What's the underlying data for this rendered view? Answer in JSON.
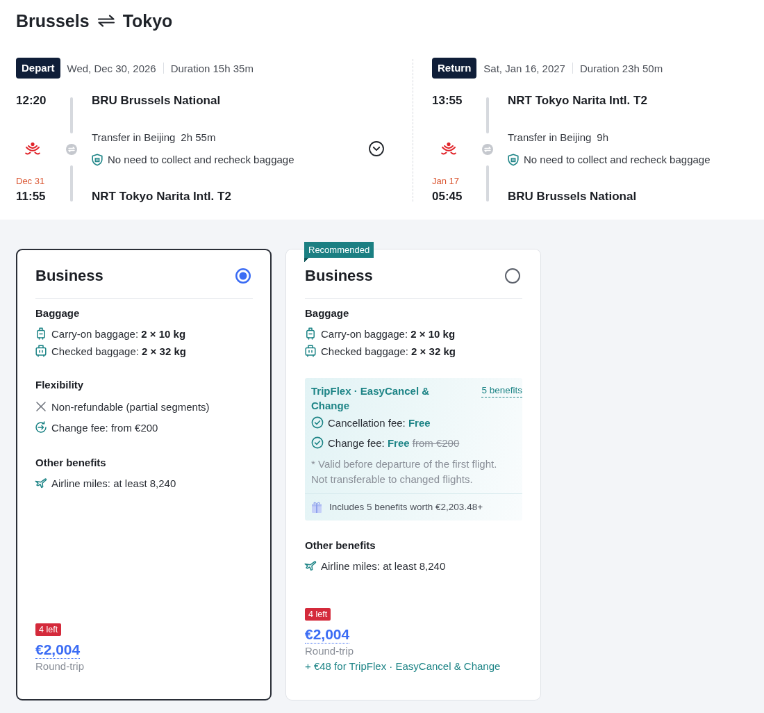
{
  "title": {
    "origin": "Brussels",
    "destination": "Tokyo"
  },
  "legs": [
    {
      "label": "Depart",
      "date": "Wed, Dec 30, 2026",
      "duration": "Duration 15h 35m",
      "expand_button": true,
      "departure": {
        "time": "12:20",
        "airport": "BRU Brussels National"
      },
      "transfer": {
        "place": "Transfer in Beijing",
        "duration": "2h 55m",
        "note": "No need to collect and recheck baggage"
      },
      "arrival": {
        "date": "Dec 31",
        "time": "11:55",
        "airport": "NRT Tokyo Narita Intl. T2"
      }
    },
    {
      "label": "Return",
      "date": "Sat, Jan 16, 2027",
      "duration": "Duration 23h 50m",
      "departure": {
        "time": "13:55",
        "airport": "NRT Tokyo Narita Intl. T2"
      },
      "transfer": {
        "place": "Transfer in Beijing",
        "duration": "9h",
        "note": "No need to collect and recheck baggage"
      },
      "arrival": {
        "date": "Jan 17",
        "time": "05:45",
        "airport": "BRU Brussels National"
      }
    }
  ],
  "fares": [
    {
      "selected": true,
      "name": "Business",
      "sections": [
        {
          "kind": "list",
          "heading": "Baggage",
          "items": [
            {
              "kind": "carry_on",
              "text": "Carry-on baggage: **2 × 10 kg**"
            },
            {
              "kind": "checked_bag",
              "text": "Checked baggage: **2 × 32 kg**"
            }
          ]
        },
        {
          "kind": "list",
          "heading": "Flexibility",
          "items": [
            {
              "kind": "not_included",
              "text": "Non-refundable (partial segments)"
            },
            {
              "kind": "change",
              "text": "Change fee: from €200"
            }
          ]
        },
        {
          "kind": "list",
          "heading": "Other benefits",
          "items": [
            {
              "kind": "miles",
              "text": "Airline miles: at least 8,240"
            }
          ]
        }
      ],
      "seats_left": "4 left",
      "price": "€2,004",
      "price_note": "Round-trip"
    },
    {
      "selected": false,
      "ribbon": "Recommended",
      "name": "Business",
      "sections": [
        {
          "kind": "list",
          "heading": "Baggage",
          "items": [
            {
              "kind": "carry_on",
              "text": "Carry-on baggage: **2 × 10 kg**"
            },
            {
              "kind": "checked_bag",
              "text": "Checked baggage: **2 × 32 kg**"
            }
          ]
        },
        {
          "kind": "package",
          "title": "TripFlex · EasyCancel & Change",
          "link": "5 benefits",
          "items": [
            {
              "label": "Cancellation fee:",
              "value": "Free"
            },
            {
              "label": "Change fee:",
              "value": "Free",
              "old_value": "from €200"
            }
          ],
          "note": "* Valid before departure of the first flight. Not transferable to changed flights.",
          "footer": "Includes 5 benefits worth €2,203.48+"
        },
        {
          "kind": "list",
          "heading": "Other benefits",
          "items": [
            {
              "kind": "miles",
              "text": "Airline miles: at least 8,240"
            }
          ]
        }
      ],
      "seats_left": "4 left",
      "price": "€2,004",
      "price_note": "Round-trip",
      "add_on": "+ €48 for TripFlex · EasyCancel & Change"
    }
  ]
}
